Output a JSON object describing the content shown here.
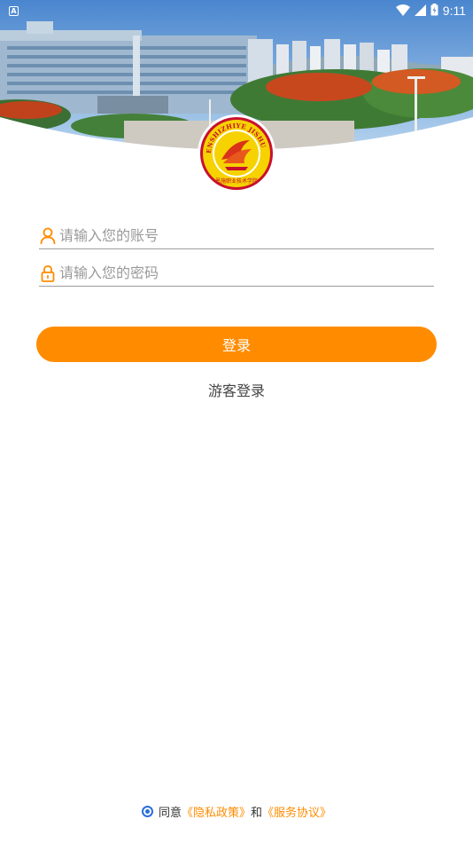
{
  "status_bar": {
    "notification_icon": "A",
    "time": "9:11",
    "icons": [
      "wifi-icon",
      "signal-icon",
      "battery-icon"
    ]
  },
  "logo": {
    "arc_text": "ENSHIZHIYE JISHU XUEYUAN",
    "bottom_text": "恩施职业技术学院"
  },
  "form": {
    "account_placeholder": "请输入您的账号",
    "password_placeholder": "请输入您的密码",
    "login_label": "登录",
    "guest_label": "游客登录"
  },
  "agreement": {
    "agree_text": "同意",
    "privacy_link": "《隐私政策》",
    "and_text": "和",
    "service_link": "《服务协议》",
    "checked": true
  },
  "colors": {
    "accent": "#ff8c00",
    "radio": "#2a6fdb",
    "divider": "#9e9e9e"
  }
}
